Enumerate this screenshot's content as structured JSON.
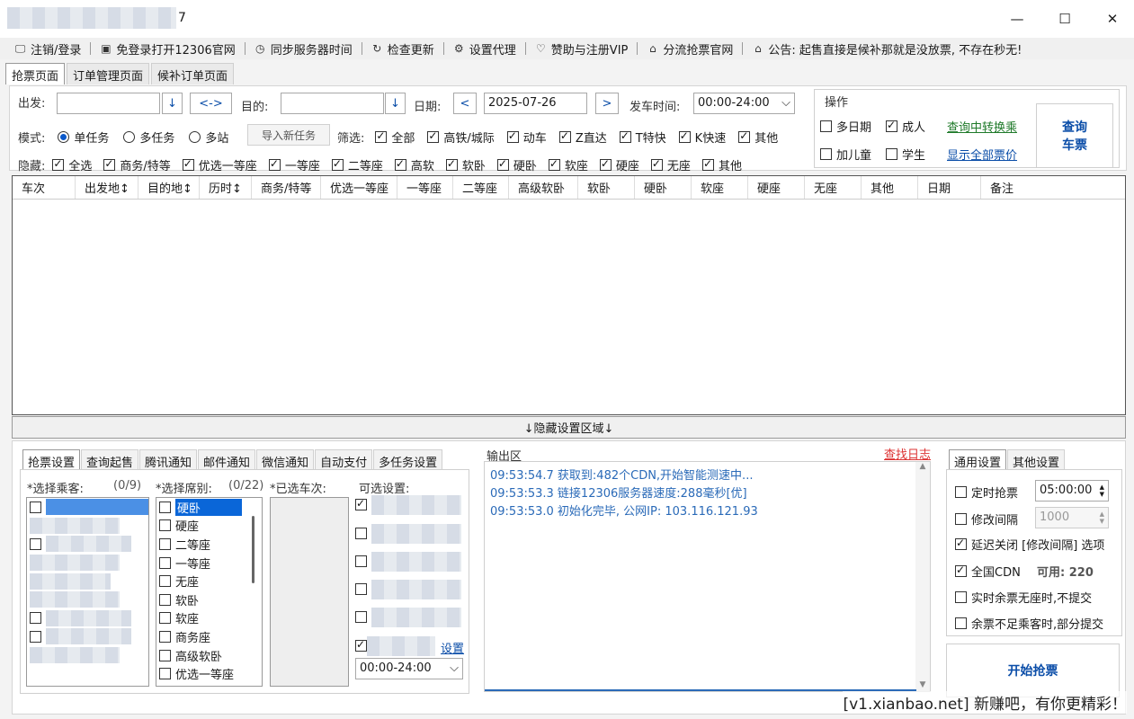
{
  "window": {
    "title_suffix": "7",
    "minimize": "—",
    "maximize": "☐",
    "close": "✕"
  },
  "menu": [
    {
      "icon": "monitor-icon",
      "glyph": "🖵",
      "label": "注销/登录"
    },
    {
      "icon": "window-icon",
      "glyph": "▣",
      "label": "免登录打开12306官网"
    },
    {
      "icon": "clock-icon",
      "glyph": "◷",
      "label": "同步服务器时间"
    },
    {
      "icon": "refresh-icon",
      "glyph": "↻",
      "label": "检查更新"
    },
    {
      "icon": "gear-icon",
      "glyph": "⚙",
      "label": "设置代理"
    },
    {
      "icon": "heart-icon",
      "glyph": "♡",
      "label": "赞助与注册VIP"
    },
    {
      "icon": "home-icon",
      "glyph": "⌂",
      "label": "分流抢票官网"
    },
    {
      "icon": "bell-icon",
      "glyph": "⌂",
      "label": "公告: 起售直接是候补那就是没放票, 不存在秒无!"
    }
  ],
  "page_tabs": [
    "抢票页面",
    "订单管理页面",
    "候补订单页面"
  ],
  "search": {
    "from_label": "出发:",
    "from_value": "",
    "swap_label": "<->",
    "to_label": "目的:",
    "to_value": "",
    "down_arrow": "↓",
    "date_label": "日期:",
    "prev": "<",
    "date_value": "2025-07-26",
    "next": ">",
    "depart_label": "发车时间:",
    "depart_value": "00:00-24:00",
    "depart_caret": "⌵"
  },
  "mode": {
    "label": "模式:",
    "options": [
      "单任务",
      "多任务",
      "多站"
    ],
    "selected": 0,
    "import_btn": "导入新任务"
  },
  "filter": {
    "label": "筛选:",
    "items": [
      "全部",
      "高铁/城际",
      "动车",
      "Z直达",
      "T特快",
      "K快速",
      "其他"
    ]
  },
  "hide": {
    "label": "隐藏:",
    "items": [
      "全选",
      "商务/特等",
      "优选一等座",
      "一等座",
      "二等座",
      "高软",
      "软卧",
      "硬卧",
      "软座",
      "硬座",
      "无座",
      "其他"
    ]
  },
  "ops": {
    "title": "操作",
    "multi_date": "多日期",
    "adult": "成人",
    "child": "加儿童",
    "student": "学生",
    "transfer_link": "查询中转换乘",
    "all_price_link": "显示全部票价",
    "query_btn_line1": "查询",
    "query_btn_line2": "车票"
  },
  "grid_headers": [
    "车次",
    "出发地↕",
    "目的地↕",
    "历时↕",
    "商务/特等",
    "优选一等座",
    "一等座",
    "二等座",
    "高级软卧",
    "软卧",
    "硬卧",
    "软座",
    "硬座",
    "无座",
    "其他",
    "日期",
    "备注"
  ],
  "hide_area": "↓隐藏设置区域↓",
  "bottom_tabs": [
    "抢票设置",
    "查询起售",
    "腾讯通知",
    "邮件通知",
    "微信通知",
    "自动支付",
    "多任务设置"
  ],
  "passengers": {
    "label": "*选择乘客:",
    "count": "(0/9)"
  },
  "seats": {
    "label": "*选择席别:",
    "count": "(0/22)",
    "items": [
      "硬卧",
      "硬座",
      "二等座",
      "一等座",
      "无座",
      "软卧",
      "软座",
      "商务座",
      "高级软卧",
      "优选一等座"
    ]
  },
  "trains": {
    "label": "*已选车次:"
  },
  "optional": {
    "label": "可选设置:",
    "settings_link": "设置",
    "time_value": "00:00-24:00",
    "caret": "⌵"
  },
  "output": {
    "label": "输出区",
    "find_log": "查找日志",
    "lines": [
      "09:53:54.7  获取到:482个CDN,开始智能测速中...",
      "09:53:53.3  链接12306服务器速度:288毫秒[优]",
      "09:53:53.0  初始化完毕, 公网IP: 103.116.121.93"
    ]
  },
  "right_tabs": [
    "通用设置",
    "其他设置"
  ],
  "general": {
    "timed": "定时抢票",
    "timed_value": "05:00:00",
    "interval": "修改间隔",
    "interval_value": "1000",
    "delay_close": "延迟关闭 [修改间隔] 选项",
    "cdn": "全国CDN",
    "cdn_avail": "可用: 220",
    "no_seat": "实时余票无座时,不提交",
    "partial": "余票不足乘客时,部分提交",
    "start_btn": "开始抢票"
  },
  "watermark": "[v1.xianbao.net] 新赚吧，有你更精彩！"
}
